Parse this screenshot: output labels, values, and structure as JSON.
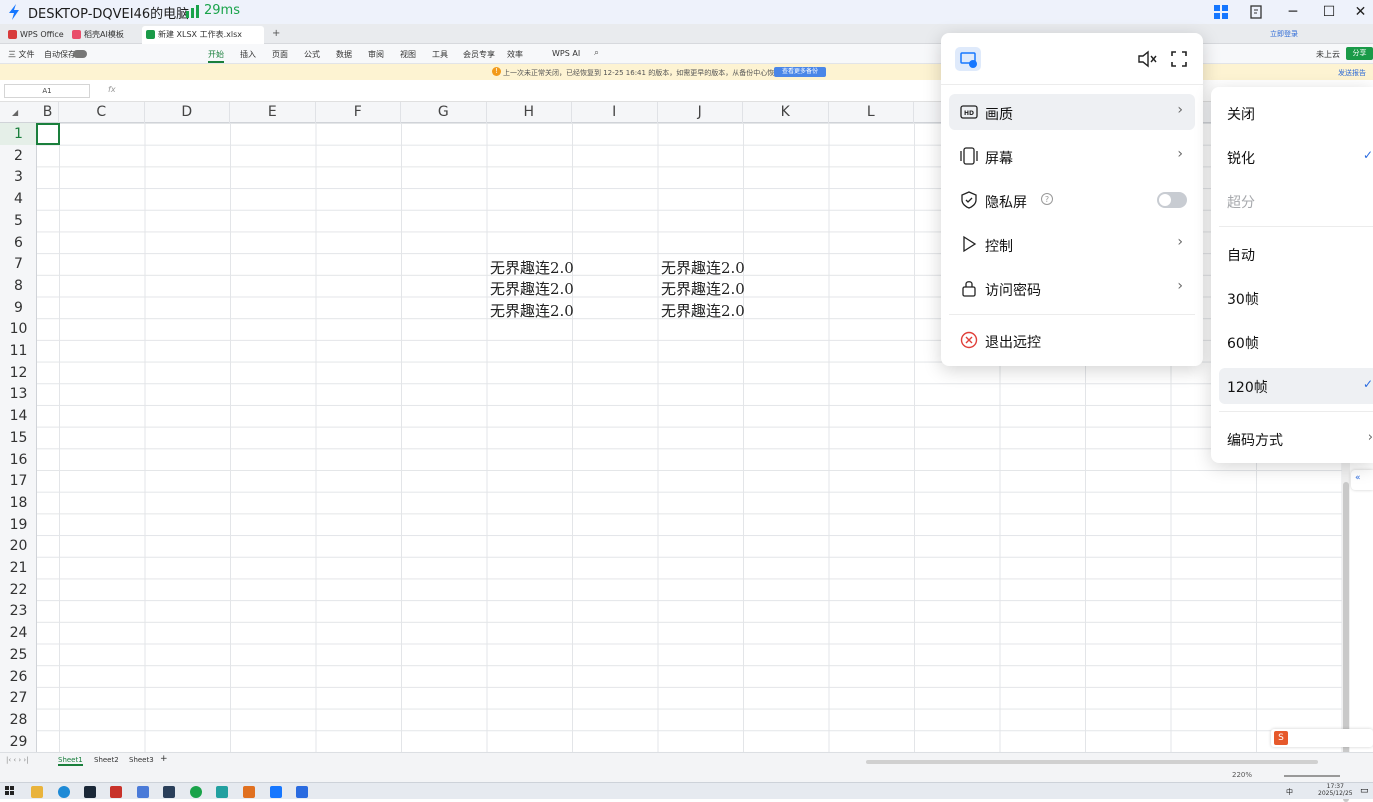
{
  "remote": {
    "title": "DESKTOP-DQVEI46的电脑",
    "ping": "29ms",
    "colors": {
      "ping": "#19a34a",
      "brand": "#1677ff"
    }
  },
  "wps": {
    "tabs": [
      {
        "label": "WPS Office"
      },
      {
        "label": "稻壳AI模板"
      },
      {
        "label": "新建 XLSX 工作表.xlsx"
      }
    ],
    "ribbon": {
      "file": "三 文件",
      "autosave": "自动保存",
      "menus": [
        "开始",
        "插入",
        "页面",
        "公式",
        "数据",
        "审阅",
        "视图",
        "工具",
        "会员专享",
        "效率",
        "WPS AI"
      ],
      "active": "开始",
      "login": "立即登录",
      "cloud": "未上云",
      "share": "分享"
    },
    "notice": {
      "text": "上一次未正常关闭，已经恢复到 12-25 16:41 的版本，如需更早的版本，从备份中心恢复",
      "button": "查看更多备份",
      "feedback": "发送报告"
    },
    "formula": {
      "namebox": "A1",
      "fx": "fx"
    },
    "columns": [
      "B",
      "C",
      "D",
      "E",
      "F",
      "G",
      "H",
      "I",
      "J",
      "K",
      "L"
    ],
    "rows": [
      "1",
      "2",
      "3",
      "4",
      "5",
      "6",
      "7",
      "8",
      "9",
      "10",
      "11",
      "12",
      "13",
      "14",
      "15",
      "16",
      "17",
      "18",
      "19",
      "20",
      "21",
      "22",
      "23",
      "24",
      "25",
      "26",
      "27",
      "28",
      "29"
    ],
    "cells": {
      "h7": "无界趣连2.0",
      "h8": "无界趣连2.0",
      "h9": "无界趣连2.0",
      "j7": "无界趣连2.0",
      "j8": "无界趣连2.0",
      "j9": "无界趣连2.0"
    },
    "sheets": [
      "Sheet1",
      "Sheet2",
      "Sheet3"
    ],
    "active_sheet": "Sheet1",
    "zoom": "220%"
  },
  "popup": {
    "items": [
      {
        "label": "画质",
        "icon": "hd-icon",
        "highlighted": true
      },
      {
        "label": "屏幕",
        "icon": "screen-icon"
      },
      {
        "label": "隐私屏",
        "icon": "shield-icon",
        "toggle": false
      },
      {
        "label": "控制",
        "icon": "play-icon"
      },
      {
        "label": "访问密码",
        "icon": "lock-icon"
      }
    ],
    "exit": "退出远控"
  },
  "submenu": {
    "items": [
      {
        "label": "关闭"
      },
      {
        "label": "锐化",
        "checked": true
      },
      {
        "label": "超分",
        "disabled": true
      },
      {
        "label": "自动"
      },
      {
        "label": "30帧"
      },
      {
        "label": "60帧"
      },
      {
        "label": "120帧",
        "checked": true,
        "highlighted": true
      },
      {
        "label": "编码方式"
      }
    ]
  },
  "taskbar": {
    "time": "17:37",
    "date": "2025/12/25",
    "ime": "中"
  }
}
